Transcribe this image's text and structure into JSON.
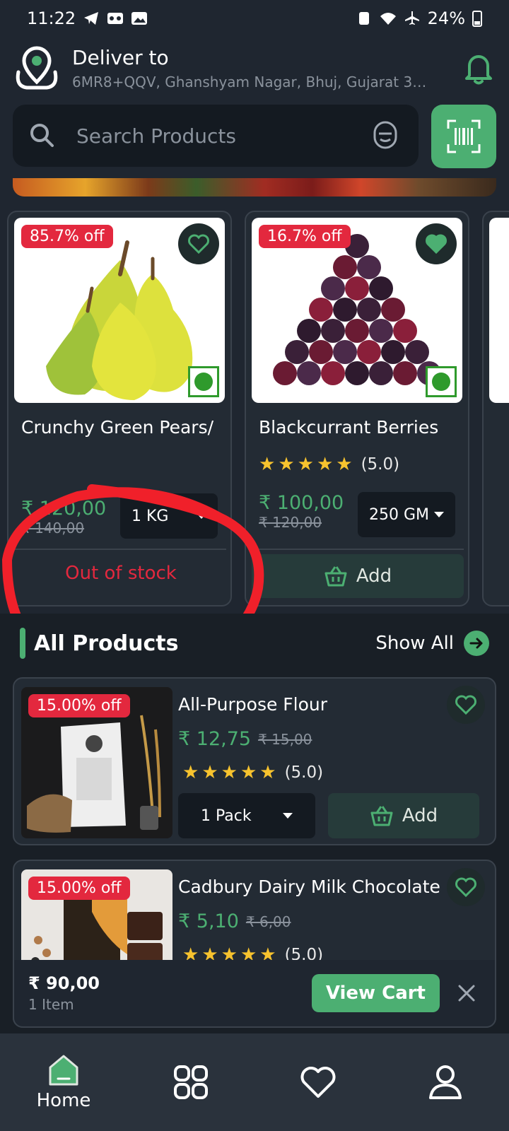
{
  "status_bar": {
    "time": "11:22",
    "battery": "24%"
  },
  "header": {
    "deliver_label": "Deliver to",
    "address": "6MR8+QQV, Ghanshyam Nagar, Bhuj, Gujarat 37..."
  },
  "search": {
    "placeholder": "Search Products"
  },
  "featured_products": [
    {
      "discount": "85.7% off",
      "name": "Crunchy Green Pears/",
      "price": "₹ 120,00",
      "old_price": "₹ 140,00",
      "unit": "1 KG",
      "status": "Out of stock",
      "favorited": false
    },
    {
      "discount": "16.7% off",
      "name": "Blackcurrant Berries",
      "rating": "(5.0)",
      "price": "₹ 100,00",
      "old_price": "₹ 120,00",
      "unit": "250 GM",
      "action": "Add",
      "favorited": true
    }
  ],
  "all_products": {
    "title": "All Products",
    "show_all": "Show All",
    "items": [
      {
        "discount": "15.00% off",
        "name": "All-Purpose Flour",
        "price": "₹ 12,75",
        "old_price": "₹ 15,00",
        "rating": "(5.0)",
        "unit": "1 Pack",
        "action": "Add"
      },
      {
        "discount": "15.00% off",
        "name": "Cadbury Dairy Milk Chocolate",
        "price": "₹ 5,10",
        "old_price": "₹ 6,00",
        "rating": "(5.0)"
      }
    ]
  },
  "cart": {
    "total": "₹ 90,00",
    "items": "1 Item",
    "button": "View Cart"
  },
  "nav": [
    {
      "label": "Home",
      "icon": "home-icon"
    },
    {
      "label": "",
      "icon": "categories-icon"
    },
    {
      "label": "",
      "icon": "heart-icon"
    },
    {
      "label": "",
      "icon": "profile-icon"
    }
  ],
  "colors": {
    "accent": "#4caf72",
    "badge": "#e3283e",
    "background": "#1f2630",
    "star": "#f7c32e"
  }
}
